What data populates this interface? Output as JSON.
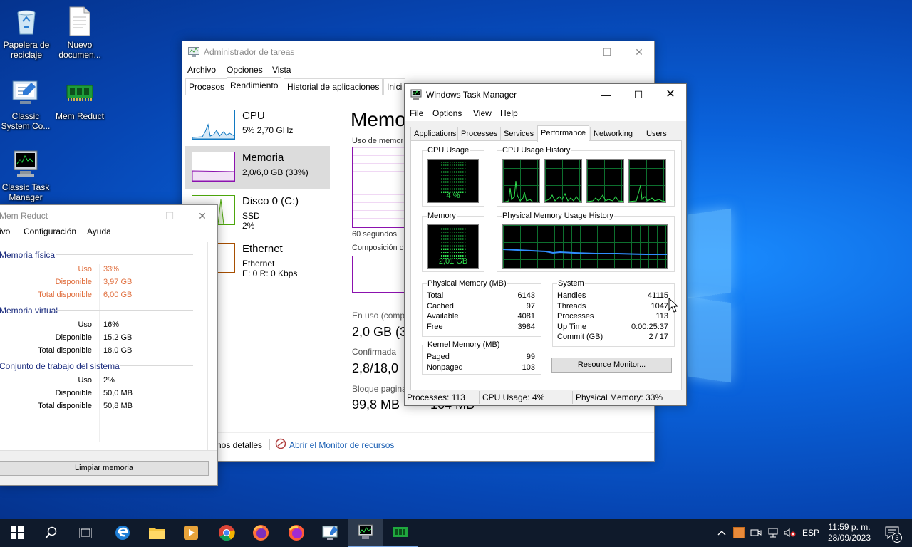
{
  "desktop": {
    "icons": [
      {
        "label": "Papelera de reciclaje",
        "icon": "recycle-bin-icon"
      },
      {
        "label": "Nuevo documen...",
        "icon": "document-icon"
      },
      {
        "label": "Classic System Co...",
        "icon": "system-config-icon"
      },
      {
        "label": "Mem Reduct",
        "icon": "memory-chip-icon"
      },
      {
        "label": "Classic Task Manager",
        "icon": "task-manager-icon"
      }
    ]
  },
  "tm_es": {
    "title": "Administrador de tareas",
    "menu": [
      "Archivo",
      "Opciones",
      "Vista"
    ],
    "tabs": [
      "Procesos",
      "Rendimiento",
      "Historial de aplicaciones",
      "Inici"
    ],
    "active_tab": "Rendimiento",
    "items": [
      {
        "name": "CPU",
        "l2": "5% 2,70 GHz",
        "l3": "",
        "color": "#1179c2"
      },
      {
        "name": "Memoria",
        "l2": "2,0/6,0 GB (33%)",
        "l3": "",
        "color": "#8b12ae"
      },
      {
        "name": "Disco 0 (C:)",
        "l2": "SSD",
        "l3": "2%",
        "color": "#4da60c"
      },
      {
        "name": "Ethernet",
        "l2": "Ethernet",
        "l3": "E: 0 R: 0 Kbps",
        "color": "#a74f01"
      }
    ],
    "main_title": "Memo",
    "uso_label": "Uso de memor",
    "seconds_label": "60 segundos",
    "composicion_label": "Composición c",
    "en_uso_label": "En uso (comp",
    "en_uso_value": "2,0 GB (3",
    "confirmada_label": "Confirmada",
    "confirmada_value": "2,8/18,0",
    "bloque_label": "Bloque pagina",
    "bloque_value": "99,8 MB",
    "bloque_value2": "164 MB",
    "fewer_details": "nos detalles",
    "open_monitor": "Abrir el Monitor de recursos"
  },
  "memr": {
    "title": "Mem Reduct",
    "menu": [
      "ivo",
      "Configuración",
      "Ayuda"
    ],
    "sections": [
      {
        "title": "Memoria física",
        "rows": [
          {
            "k": "Uso",
            "v": "33%"
          },
          {
            "k": "Disponible",
            "v": "3,97 GB"
          },
          {
            "k": "Total disponible",
            "v": "6,00 GB"
          }
        ]
      },
      {
        "title": "Memoria virtual",
        "rows": [
          {
            "k": "Uso",
            "v": "16%"
          },
          {
            "k": "Disponible",
            "v": "15,2 GB"
          },
          {
            "k": "Total disponible",
            "v": "18,0 GB"
          }
        ]
      },
      {
        "title": "Conjunto de trabajo del sistema",
        "rows": [
          {
            "k": "Uso",
            "v": "2%"
          },
          {
            "k": "Disponible",
            "v": "50,0 MB"
          },
          {
            "k": "Total disponible",
            "v": "50,8 MB"
          }
        ]
      }
    ],
    "clean_button": "Limpiar memoria"
  },
  "tm_classic": {
    "title": "Windows Task Manager",
    "menu": [
      "File",
      "Options",
      "View",
      "Help"
    ],
    "tabs": [
      "Applications",
      "Processes",
      "Services",
      "Performance",
      "Networking",
      "Users"
    ],
    "active_tab": "Performance",
    "cpu_usage_label": "CPU Usage",
    "cpu_usage_value": "4 %",
    "cpu_usage_fraction": 0.04,
    "cpu_history_label": "CPU Usage History",
    "memory_label": "Memory",
    "memory_value": "2,01 GB",
    "memory_fraction": 0.33,
    "mem_history_label": "Physical Memory Usage History",
    "physical": {
      "title": "Physical Memory (MB)",
      "rows": [
        {
          "k": "Total",
          "v": "6143"
        },
        {
          "k": "Cached",
          "v": "97"
        },
        {
          "k": "Available",
          "v": "4081"
        },
        {
          "k": "Free",
          "v": "3984"
        }
      ]
    },
    "kernel": {
      "title": "Kernel Memory (MB)",
      "rows": [
        {
          "k": "Paged",
          "v": "99"
        },
        {
          "k": "Nonpaged",
          "v": "103"
        }
      ]
    },
    "system": {
      "title": "System",
      "rows": [
        {
          "k": "Handles",
          "v": "41115"
        },
        {
          "k": "Threads",
          "v": "1047"
        },
        {
          "k": "Processes",
          "v": "113"
        },
        {
          "k": "Up Time",
          "v": "0:00:25:37"
        },
        {
          "k": "Commit (GB)",
          "v": "2 / 17"
        }
      ]
    },
    "resource_monitor_button": "Resource Monitor...",
    "status": {
      "processes": "Processes: 113",
      "cpu": "CPU Usage: 4%",
      "memory": "Physical Memory: 33%"
    }
  },
  "taskbar": {
    "apps": [
      "start-icon",
      "search-icon",
      "task-view-icon",
      "edge-icon",
      "file-explorer-icon",
      "media-player-icon",
      "chrome-icon",
      "firefox-icon",
      "firefox-dev-icon",
      "system-config-icon",
      "task-manager-icon",
      "mem-reduct-icon"
    ],
    "language": "ESP",
    "time": "11:59 p. m.",
    "date": "28/09/2023",
    "notifications_count": "3"
  }
}
